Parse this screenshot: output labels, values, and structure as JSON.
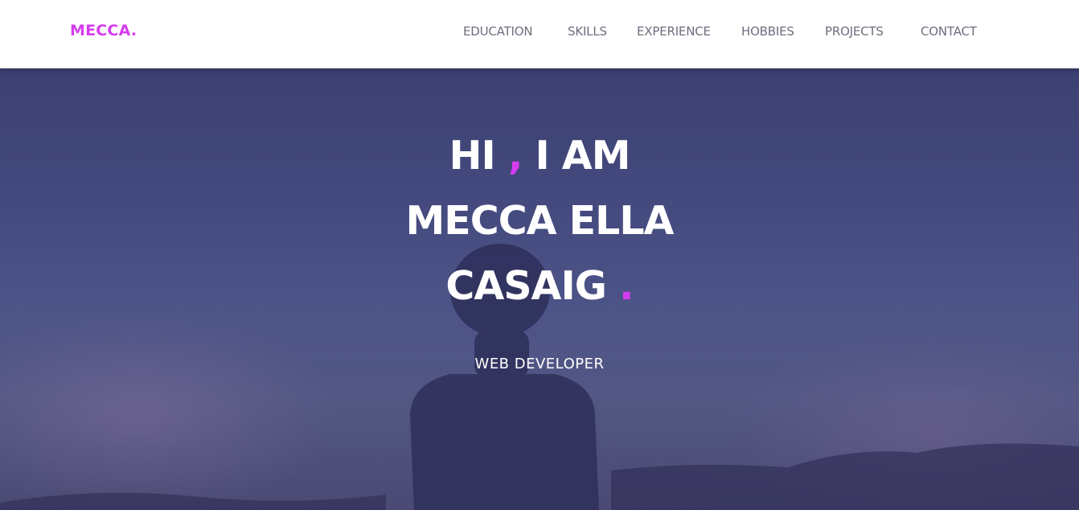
{
  "navbar": {
    "brand": "MECCA.",
    "links": [
      "EDUCATION",
      "SKILLS",
      "EXPERIENCE",
      "HOBBIES",
      "PROJECTS",
      "CONTACT"
    ]
  },
  "hero": {
    "line1_pre": "HI ",
    "line1_comma": ",",
    "line1_post": " I AM",
    "line2": "MECCA ELLA",
    "line3": "CASAIG ",
    "line3_dot": ".",
    "subtitle": "WEB DEVELOPER"
  },
  "colors": {
    "accent": "#d63cf0",
    "nav_text": "#6c6f7d",
    "hero_overlay": "#3d416e"
  }
}
